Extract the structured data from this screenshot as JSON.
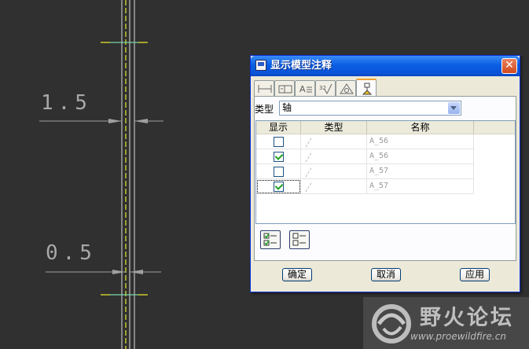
{
  "drawing": {
    "dim_top": "1.5",
    "dim_bottom": "0.5"
  },
  "dialog": {
    "title": "显示模型注释",
    "close_glyph": "✕",
    "tabs": [
      "dimension",
      "geometric-tolerance",
      "note",
      "surface-finish",
      "symbol",
      "datum"
    ],
    "active_tab": "datum",
    "type_label": "类型",
    "type_value": "轴",
    "columns": {
      "show": "显示",
      "type": "类型",
      "name": "名称"
    },
    "rows": [
      {
        "checked": false,
        "name": "A_56"
      },
      {
        "checked": true,
        "name": "A_56"
      },
      {
        "checked": false,
        "name": "A_57"
      },
      {
        "checked": true,
        "name": "A_57"
      }
    ],
    "buttons": {
      "ok": "确定",
      "cancel": "取消",
      "apply": "应用"
    }
  },
  "watermark": {
    "title": "野火论坛",
    "url": "www.proewildfire.cn"
  }
}
